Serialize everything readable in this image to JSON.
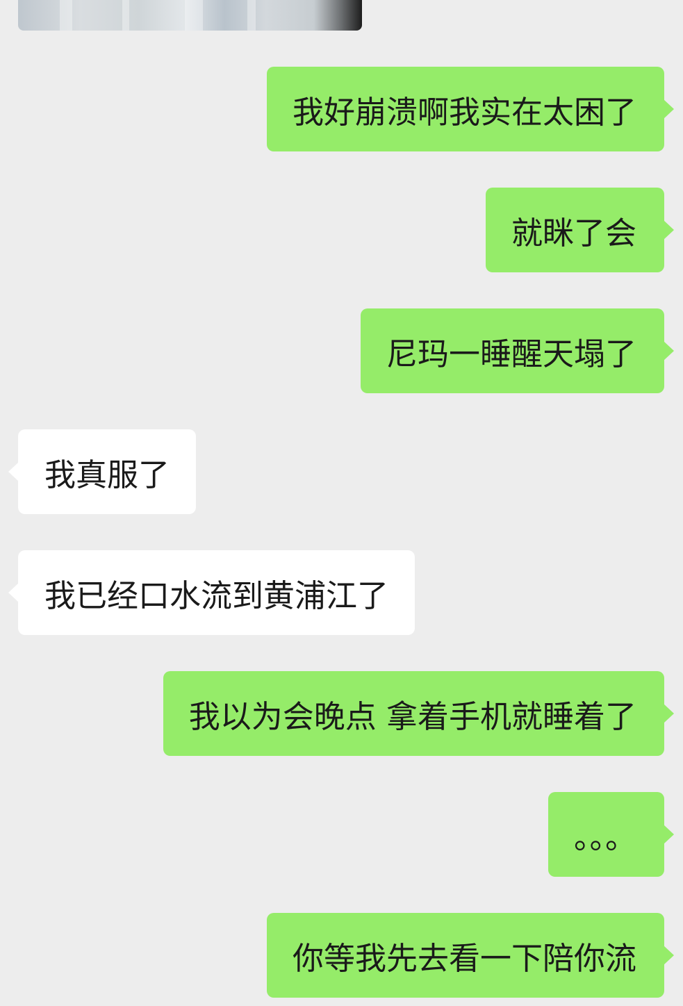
{
  "messages": [
    {
      "side": "me",
      "text": "我好崩溃啊我实在太困了"
    },
    {
      "side": "me",
      "text": "就眯了会"
    },
    {
      "side": "me",
      "text": "尼玛一睡醒天塌了"
    },
    {
      "side": "them",
      "text": "我真服了"
    },
    {
      "side": "them",
      "text": "我已经口水流到黄浦江了"
    },
    {
      "side": "me",
      "text": "我以为会晚点 拿着手机就睡着了"
    },
    {
      "side": "me",
      "text": "。。。"
    },
    {
      "side": "me",
      "text": "你等我先去看一下陪你流"
    }
  ],
  "colors": {
    "background": "#ededed",
    "outgoing_bubble": "#95ec69",
    "incoming_bubble": "#ffffff",
    "text": "#1a1a1a"
  }
}
